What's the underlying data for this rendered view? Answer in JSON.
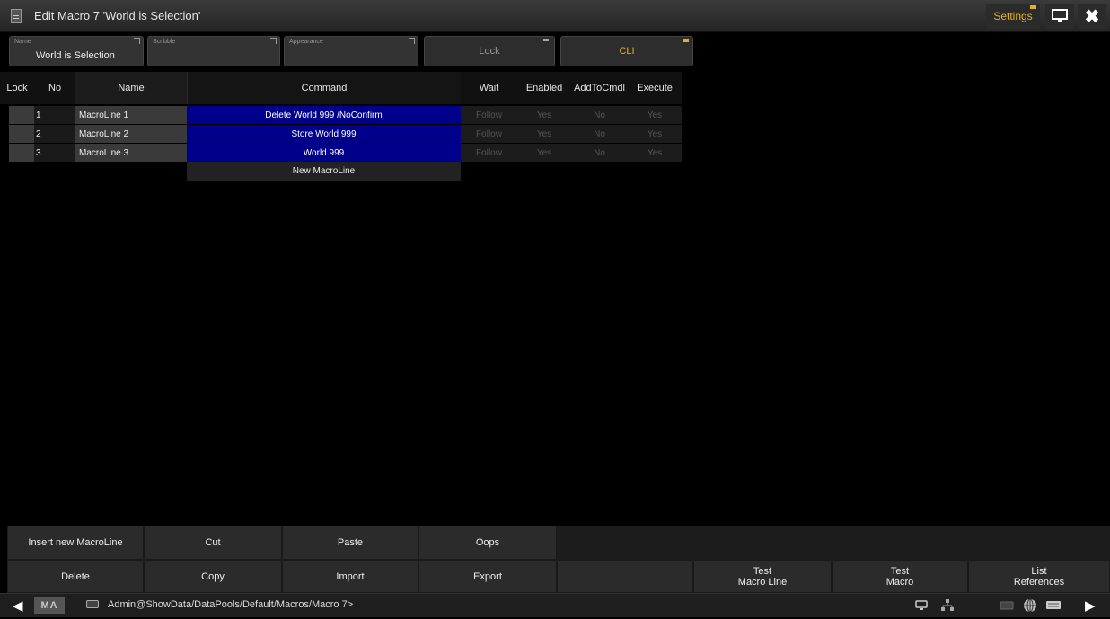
{
  "window": {
    "title": "Edit Macro 7 'World is Selection'",
    "settings_label": "Settings"
  },
  "fields": {
    "name_label": "Name",
    "name_value": "World is Selection",
    "scribble_label": "Scribble",
    "appearance_label": "Appearance",
    "lock_label": "Lock",
    "cli_label": "CLI"
  },
  "table": {
    "headers": {
      "lock": "Lock",
      "no": "No",
      "name": "Name",
      "command": "Command",
      "wait": "Wait",
      "enabled": "Enabled",
      "addtocmdl": "AddToCmdl",
      "execute": "Execute"
    },
    "rows": [
      {
        "no": "1",
        "name": "MacroLine 1",
        "command": "Delete World 999 /NoConfirm",
        "wait": "Follow",
        "enabled": "Yes",
        "addtocmdl": "No",
        "execute": "Yes"
      },
      {
        "no": "2",
        "name": "MacroLine 2",
        "command": "Store World 999",
        "wait": "Follow",
        "enabled": "Yes",
        "addtocmdl": "No",
        "execute": "Yes"
      },
      {
        "no": "3",
        "name": "MacroLine 3",
        "command": "World 999",
        "wait": "Follow",
        "enabled": "Yes",
        "addtocmdl": "No",
        "execute": "Yes"
      }
    ],
    "new_line_label": "New MacroLine"
  },
  "buttons": {
    "insert": "Insert new MacroLine",
    "cut": "Cut",
    "paste": "Paste",
    "oops": "Oops",
    "delete": "Delete",
    "copy": "Copy",
    "import": "Import",
    "export": "Export",
    "test_line": "Test\nMacro Line",
    "test_macro": "Test\nMacro",
    "list_refs": "List\nReferences"
  },
  "status": {
    "logo": "MA",
    "path": "Admin@ShowData/DataPools/Default/Macros/Macro 7>"
  },
  "colors": {
    "accent_yellow": "#e2b21a",
    "command_blue": "#00008a"
  }
}
